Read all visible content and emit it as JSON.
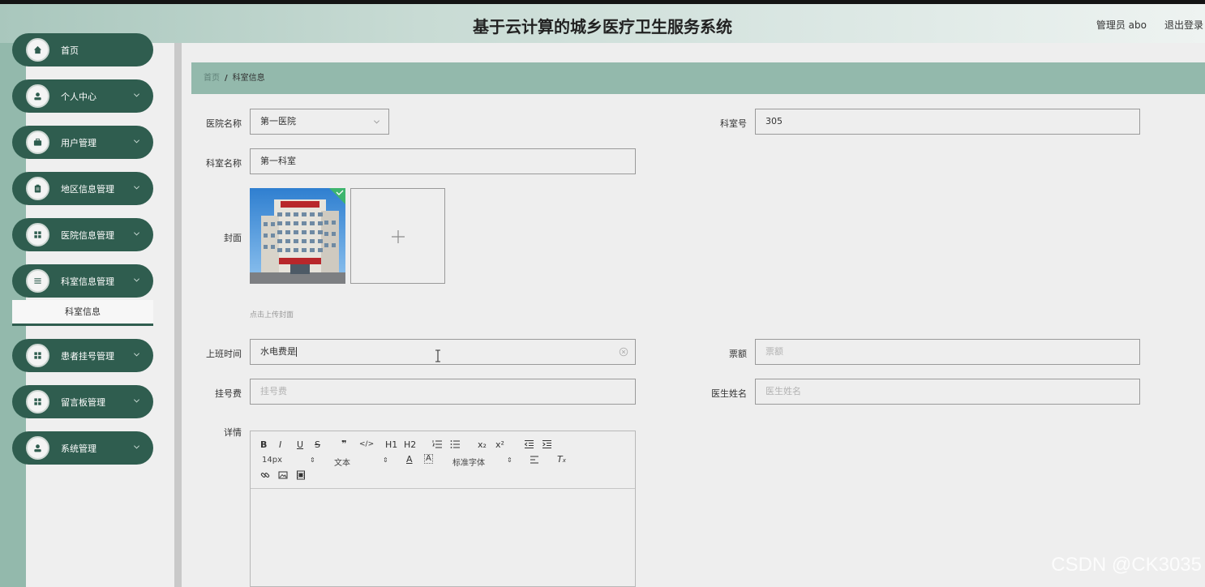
{
  "app": {
    "title": "基于云计算的城乡医疗卫生服务系统",
    "user_label": "管理员 abo",
    "logout_label": "退出登录"
  },
  "sidebar": {
    "items": [
      {
        "label": "首页",
        "icon": "home-icon"
      },
      {
        "label": "个人中心",
        "icon": "user-icon"
      },
      {
        "label": "用户管理",
        "icon": "briefcase-icon"
      },
      {
        "label": "地区信息管理",
        "icon": "clipboard-icon"
      },
      {
        "label": "医院信息管理",
        "icon": "grid-icon"
      },
      {
        "label": "科室信息管理",
        "icon": "list-icon"
      },
      {
        "label": "患者挂号管理",
        "icon": "grid-icon"
      },
      {
        "label": "留言板管理",
        "icon": "grid-icon"
      },
      {
        "label": "系统管理",
        "icon": "user-icon"
      }
    ],
    "submenu_active": "科室信息"
  },
  "breadcrumb": {
    "home": "首页",
    "separator": "/",
    "current": "科室信息"
  },
  "form": {
    "hospital_name": {
      "label": "医院名称",
      "value": "第一医院"
    },
    "room_no": {
      "label": "科室号",
      "value": "305"
    },
    "dept_name": {
      "label": "科室名称",
      "value": "第一科室"
    },
    "cover": {
      "label": "封面",
      "hint": "点击上传封面"
    },
    "work_time": {
      "label": "上班时间",
      "value": "水电费是"
    },
    "ticket": {
      "label": "票额",
      "placeholder": "票额"
    },
    "reg_fee": {
      "label": "挂号费",
      "placeholder": "挂号费"
    },
    "doctor_name": {
      "label": "医生姓名",
      "placeholder": "医生姓名"
    },
    "detail": {
      "label": "详情"
    }
  },
  "editor": {
    "row1": [
      "B",
      "I",
      "U",
      "S",
      "❞",
      "</>",
      "H1",
      "H2",
      "ol",
      "ul",
      "x₂",
      "x²",
      "outdent",
      "indent"
    ],
    "font_size": "14px",
    "text_style": "文本",
    "font_family": "标准字体"
  },
  "watermark": "CSDN @CK3035",
  "colors": {
    "sidebar_pill": "#2f5d4f",
    "accent": "#93b9ac"
  }
}
